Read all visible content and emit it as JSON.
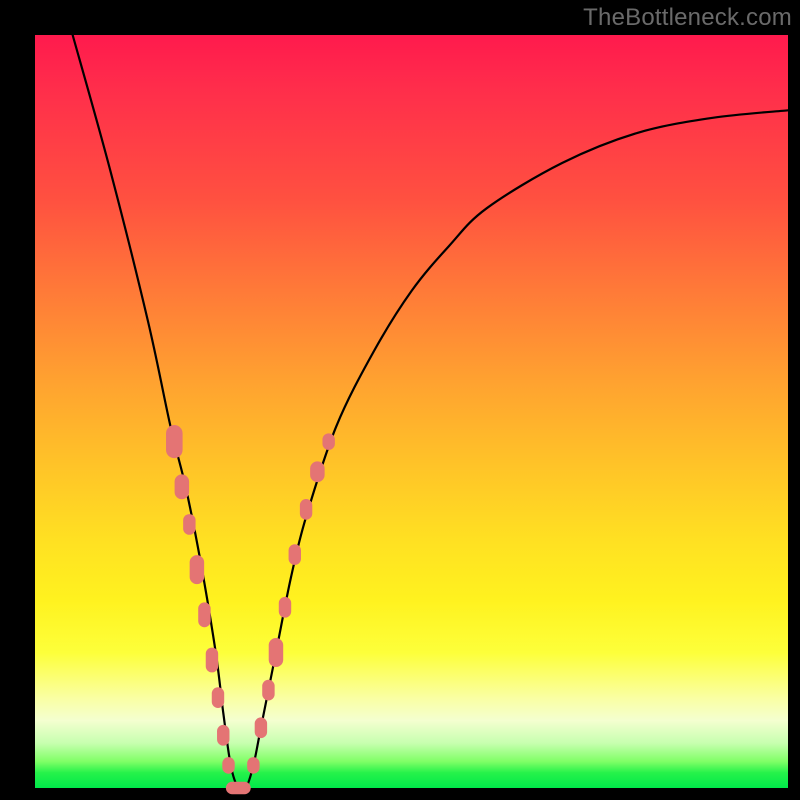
{
  "watermark": "TheBottleneck.com",
  "colors": {
    "background": "#000000",
    "gradient_top": "#ff1a4d",
    "gradient_mid": "#ffe022",
    "gradient_bottom": "#00e84a",
    "curve": "#000000",
    "marker": "#e47474"
  },
  "chart_data": {
    "type": "line",
    "title": "",
    "xlabel": "",
    "ylabel": "",
    "xlim": [
      0,
      100
    ],
    "ylim": [
      0,
      100
    ],
    "note": "V-shaped bottleneck curve; y represents bottleneck % (0 = perfect match at valley). Minimum near x≈27. Values are estimated from the image (no axes shown).",
    "series": [
      {
        "name": "bottleneck-curve",
        "x": [
          5,
          10,
          15,
          18,
          20,
          22,
          24,
          25,
          26,
          27,
          28,
          29,
          30,
          32,
          34,
          36,
          40,
          45,
          50,
          55,
          60,
          70,
          80,
          90,
          100
        ],
        "y": [
          100,
          82,
          62,
          48,
          40,
          30,
          18,
          10,
          3,
          0,
          0,
          3,
          8,
          18,
          28,
          36,
          48,
          58,
          66,
          72,
          77,
          83,
          87,
          89,
          90
        ]
      }
    ],
    "markers": {
      "name": "highlighted-points",
      "note": "Pink rounded-rectangle markers clustered near the valley on both branches",
      "points": [
        {
          "x": 18.5,
          "y": 46,
          "w": 4.0,
          "h": 8
        },
        {
          "x": 19.5,
          "y": 40,
          "w": 3.5,
          "h": 6
        },
        {
          "x": 20.5,
          "y": 35,
          "w": 3.0,
          "h": 5
        },
        {
          "x": 21.5,
          "y": 29,
          "w": 3.5,
          "h": 7
        },
        {
          "x": 22.5,
          "y": 23,
          "w": 3.0,
          "h": 6
        },
        {
          "x": 23.5,
          "y": 17,
          "w": 3.0,
          "h": 6
        },
        {
          "x": 24.3,
          "y": 12,
          "w": 3.0,
          "h": 5
        },
        {
          "x": 25.0,
          "y": 7,
          "w": 3.0,
          "h": 5
        },
        {
          "x": 25.7,
          "y": 3,
          "w": 3.0,
          "h": 4
        },
        {
          "x": 27.0,
          "y": 0,
          "w": 6.0,
          "h": 3
        },
        {
          "x": 29.0,
          "y": 3,
          "w": 3.0,
          "h": 4
        },
        {
          "x": 30.0,
          "y": 8,
          "w": 3.0,
          "h": 5
        },
        {
          "x": 31.0,
          "y": 13,
          "w": 3.0,
          "h": 5
        },
        {
          "x": 32.0,
          "y": 18,
          "w": 3.5,
          "h": 7
        },
        {
          "x": 33.2,
          "y": 24,
          "w": 3.0,
          "h": 5
        },
        {
          "x": 34.5,
          "y": 31,
          "w": 3.0,
          "h": 5
        },
        {
          "x": 36.0,
          "y": 37,
          "w": 3.0,
          "h": 5
        },
        {
          "x": 37.5,
          "y": 42,
          "w": 3.5,
          "h": 5
        },
        {
          "x": 39.0,
          "y": 46,
          "w": 3.0,
          "h": 4
        }
      ]
    }
  }
}
